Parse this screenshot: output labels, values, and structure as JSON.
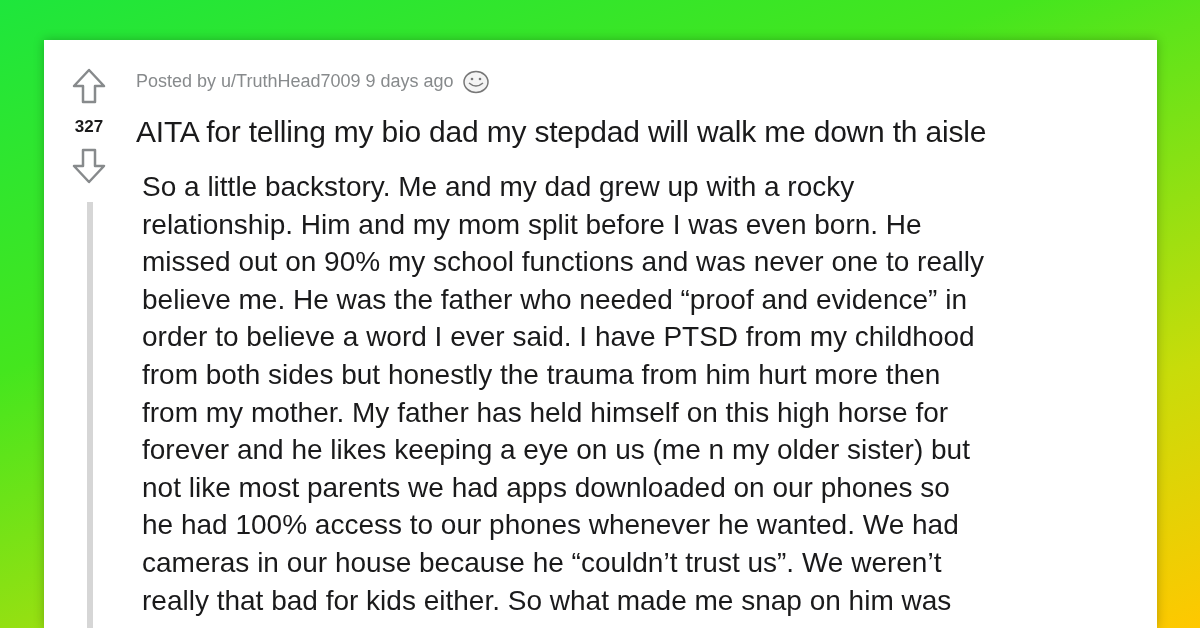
{
  "post": {
    "vote_count": "327",
    "meta": "Posted by u/TruthHead7009 9 days ago",
    "title": "AITA for telling my bio dad my stepdad will walk me down th aisle",
    "body_lines": [
      "So a little backstory. Me and my dad grew up with a rocky",
      "relationship. Him and my mom split before I was even born. He",
      "missed out on 90% my school functions and was never one to really",
      "believe me. He was the father who needed “proof and evidence” in",
      "order to believe a word I ever said. I have PTSD from my childhood",
      "from both sides but honestly the trauma from him hurt more then",
      "from my mother. My father has held himself on this high horse for",
      "forever and he likes keeping a eye on us (me n my older sister) but",
      "not like most parents we had apps downloaded on our phones so",
      "he had 100% access to our phones whenever he wanted. We had",
      "cameras in our house because he “couldn’t trust us”. We weren’t",
      "really that bad for kids either. So what made me snap on him was"
    ]
  }
}
